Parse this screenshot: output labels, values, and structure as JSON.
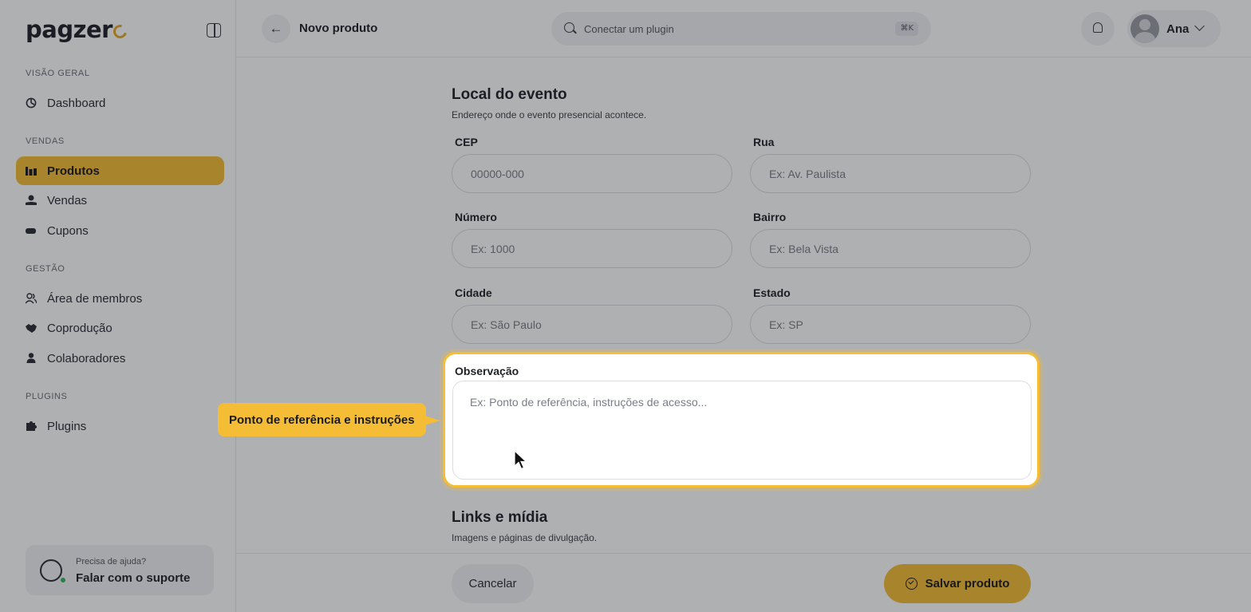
{
  "app": {
    "logo_text": "pagzer",
    "brand_color": "#f5bd36"
  },
  "sidebar": {
    "sections": [
      {
        "label": "VISÃO GERAL"
      },
      {
        "label": "VENDAS"
      },
      {
        "label": "GESTÃO"
      },
      {
        "label": "PLUGINS"
      }
    ],
    "items": [
      {
        "label": "Dashboard",
        "icon": "dashboard-icon"
      },
      {
        "label": "Produtos",
        "icon": "products-icon",
        "active": true
      },
      {
        "label": "Vendas",
        "icon": "sales-icon"
      },
      {
        "label": "Cupons",
        "icon": "coupon-icon"
      },
      {
        "label": "Área de membros",
        "icon": "members-icon"
      },
      {
        "label": "Coprodução",
        "icon": "handshake-icon"
      },
      {
        "label": "Colaboradores",
        "icon": "user-icon"
      },
      {
        "label": "Plugins",
        "icon": "puzzle-icon"
      }
    ],
    "help": {
      "title": "Precisa de ajuda?",
      "action": "Falar com o suporte"
    }
  },
  "topbar": {
    "page_title": "Novo produto",
    "search_placeholder": "Conectar um plugin",
    "search_shortcut": "⌘K",
    "user_name": "Ana"
  },
  "form": {
    "location": {
      "title": "Local do evento",
      "subtitle": "Endereço onde o evento presencial acontece.",
      "fields": {
        "cep": {
          "label": "CEP",
          "placeholder": "00000-000",
          "value": ""
        },
        "rua": {
          "label": "Rua",
          "placeholder": "Ex: Av. Paulista",
          "value": ""
        },
        "numero": {
          "label": "Número",
          "placeholder": "Ex: 1000",
          "value": ""
        },
        "bairro": {
          "label": "Bairro",
          "placeholder": "Ex: Bela Vista",
          "value": ""
        },
        "cidade": {
          "label": "Cidade",
          "placeholder": "Ex: São Paulo",
          "value": ""
        },
        "estado": {
          "label": "Estado",
          "placeholder": "Ex: SP",
          "value": ""
        },
        "observacao": {
          "label": "Observação",
          "placeholder": "Ex: Ponto de referência, instruções de acesso...",
          "value": ""
        }
      }
    },
    "media": {
      "title": "Links e mídia",
      "subtitle": "Imagens e páginas de divulgação."
    }
  },
  "footer": {
    "cancel_label": "Cancelar",
    "save_label": "Salvar produto"
  },
  "tour": {
    "tooltip_text": "Ponto de referência e instruções"
  }
}
